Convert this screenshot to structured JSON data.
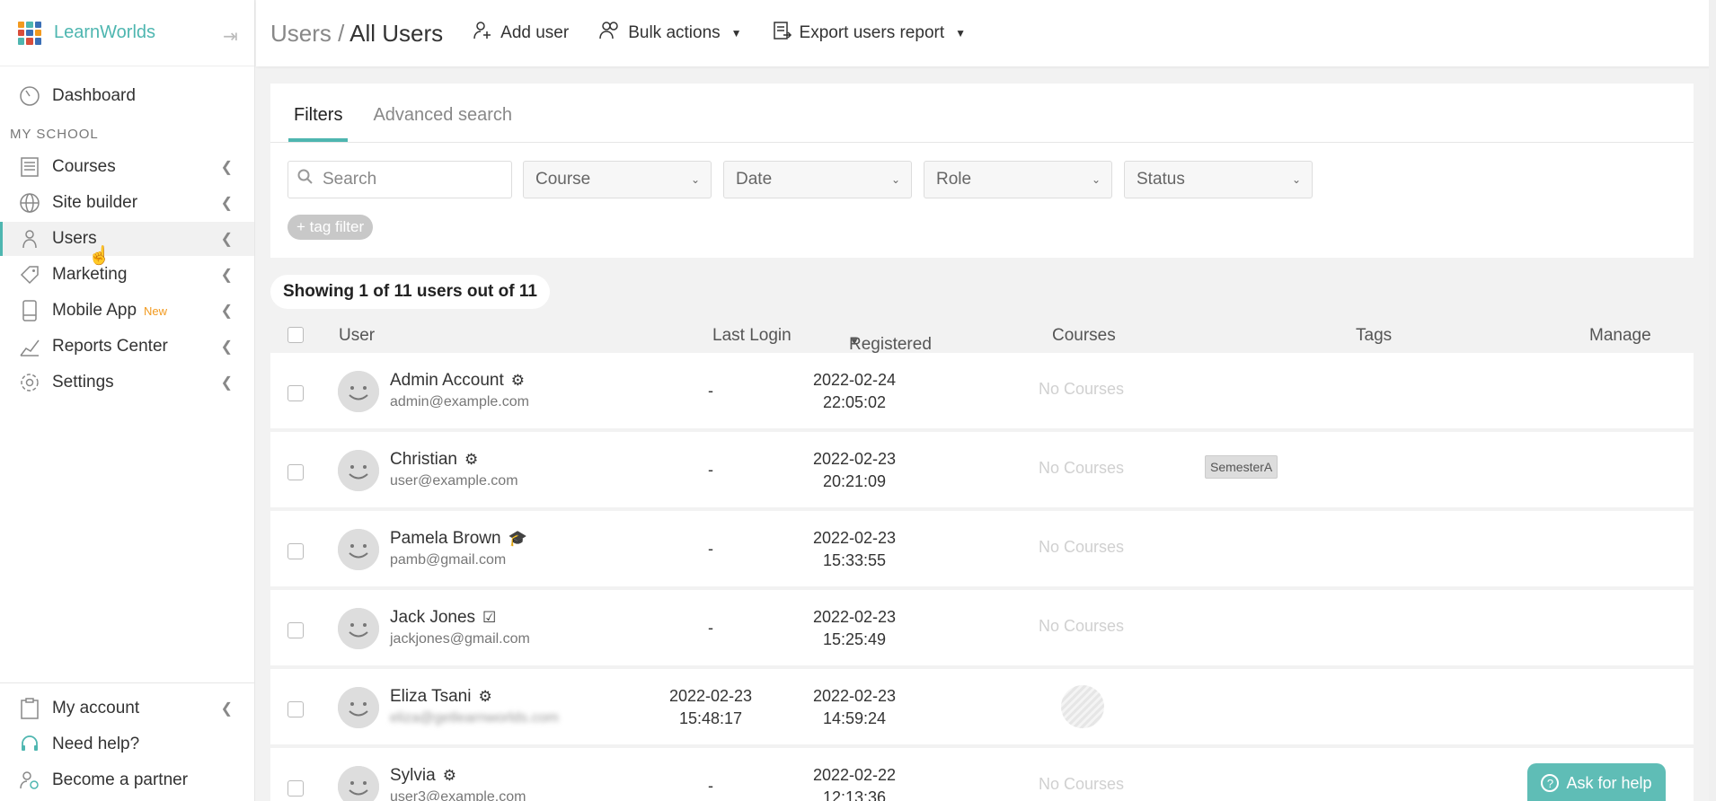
{
  "brand": {
    "name": "LearnWorlds"
  },
  "sidebar": {
    "section_label": "MY SCHOOL",
    "items": [
      {
        "label": "Dashboard",
        "icon": "dashboard-icon"
      },
      {
        "label": "Courses",
        "icon": "courses-icon"
      },
      {
        "label": "Site builder",
        "icon": "globe-icon"
      },
      {
        "label": "Users",
        "icon": "user-icon"
      },
      {
        "label": "Marketing",
        "icon": "tag-icon"
      },
      {
        "label": "Mobile App",
        "icon": "mobile-icon",
        "badge": "New"
      },
      {
        "label": "Reports Center",
        "icon": "chart-icon"
      },
      {
        "label": "Settings",
        "icon": "gear-icon"
      }
    ],
    "bottom_items": [
      {
        "label": "My account",
        "icon": "clipboard-icon"
      },
      {
        "label": "Need help?",
        "icon": "headset-icon"
      },
      {
        "label": "Become a partner",
        "icon": "partner-icon"
      }
    ]
  },
  "header": {
    "crumb_parent": "Users /",
    "crumb_current": "All Users",
    "add_user": "Add user",
    "bulk_actions": "Bulk actions",
    "export_report": "Export users report"
  },
  "filters": {
    "tab_filters": "Filters",
    "tab_advanced": "Advanced search",
    "search_placeholder": "Search",
    "course": "Course",
    "date": "Date",
    "role": "Role",
    "status": "Status",
    "tag_filter": "+ tag filter"
  },
  "summary": {
    "count_text": "Showing 1 of 11 users out of 11"
  },
  "table": {
    "columns": {
      "user": "User",
      "last_login": "Last Login",
      "registered": "Registered",
      "courses": "Courses",
      "tags": "Tags",
      "manage": "Manage"
    },
    "rows": [
      {
        "name": "Admin Account",
        "email": "admin@example.com",
        "last_login_1": "-",
        "last_login_2": "",
        "reg_date": "2022-02-24",
        "reg_time": "22:05:02",
        "courses": "No Courses",
        "tag": ""
      },
      {
        "name": "Christian",
        "email": "user@example.com",
        "last_login_1": "-",
        "last_login_2": "",
        "reg_date": "2022-02-23",
        "reg_time": "20:21:09",
        "courses": "No Courses",
        "tag": "SemesterA"
      },
      {
        "name": "Pamela Brown",
        "email": "pamb@gmail.com",
        "last_login_1": "-",
        "last_login_2": "",
        "reg_date": "2022-02-23",
        "reg_time": "15:33:55",
        "courses": "No Courses",
        "tag": ""
      },
      {
        "name": "Jack Jones",
        "email": "jackjones@gmail.com",
        "last_login_1": "-",
        "last_login_2": "",
        "reg_date": "2022-02-23",
        "reg_time": "15:25:49",
        "courses": "No Courses",
        "tag": ""
      },
      {
        "name": "Eliza Tsani",
        "email": "eliza@getlearnworlds.com",
        "last_login_1": "2022-02-23",
        "last_login_2": "15:48:17",
        "reg_date": "2022-02-23",
        "reg_time": "14:59:24",
        "courses": "",
        "tag": ""
      },
      {
        "name": "Sylvia",
        "email": "user3@example.com",
        "last_login_1": "-",
        "last_login_2": "",
        "reg_date": "2022-02-22",
        "reg_time": "12:13:36",
        "courses": "No Courses",
        "tag": ""
      }
    ]
  },
  "help": {
    "label": "Ask for help"
  },
  "colors": {
    "accent": "#4eb6b0",
    "orange": "#f29a1f"
  }
}
